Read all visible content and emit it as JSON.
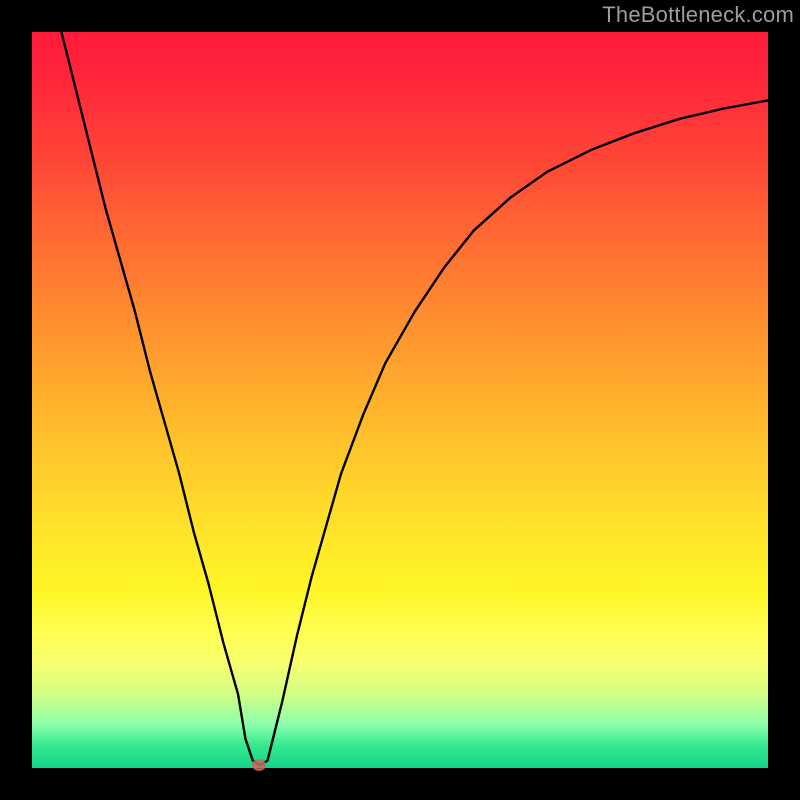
{
  "watermark": "TheBottleneck.com",
  "colors": {
    "curve": "#000000",
    "marker": "#c96b5f",
    "frame": "#000000"
  },
  "chart_data": {
    "type": "line",
    "title": "",
    "xlabel": "",
    "ylabel": "",
    "xlim": [
      0,
      100
    ],
    "ylim": [
      0,
      100
    ],
    "grid": false,
    "series": [
      {
        "name": "bottleneck-curve",
        "x": [
          4,
          6,
          8,
          10,
          12,
          14,
          16,
          18,
          20,
          22,
          24,
          26,
          28,
          29,
          30,
          31,
          32,
          34,
          36,
          38,
          40,
          42,
          45,
          48,
          52,
          56,
          60,
          65,
          70,
          76,
          82,
          88,
          94,
          100
        ],
        "values": [
          100,
          92,
          84,
          76,
          69,
          62,
          54,
          47,
          40,
          32,
          25,
          17,
          10,
          4,
          1,
          0.4,
          1,
          9,
          18,
          26,
          33,
          40,
          48,
          55,
          62,
          68,
          73,
          77.5,
          81,
          84,
          86.3,
          88.2,
          89.6,
          90.7
        ]
      }
    ],
    "marker": {
      "x": 30.8,
      "y": 0.4
    },
    "note": "Values estimated from pixel positions; axes have no visible tick labels."
  }
}
